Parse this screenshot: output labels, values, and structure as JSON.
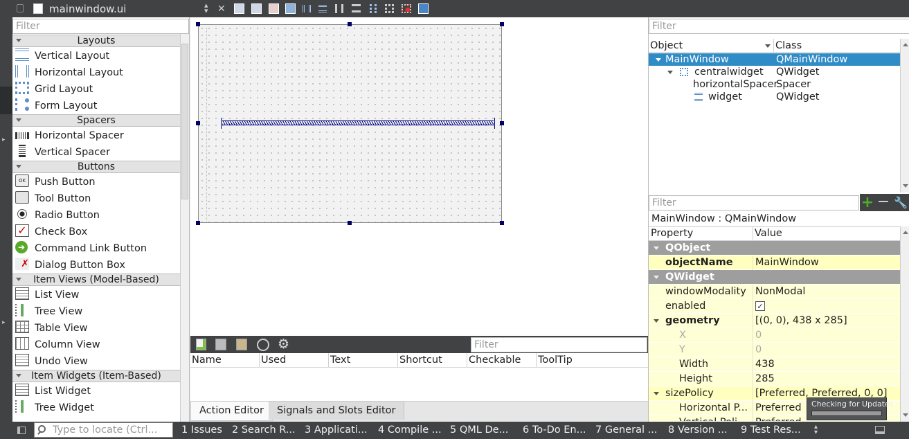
{
  "topbar": {
    "file_name": "mainwindow.ui",
    "close_symbol": "✕",
    "toolbar_icons": [
      "edit-widgets-icon",
      "edit-signals-icon",
      "edit-buddies-icon",
      "edit-tab-order-icon",
      "layout-horizontal-icon",
      "layout-vertical-icon",
      "layout-h-splitter-icon",
      "layout-v-splitter-icon",
      "layout-form-icon",
      "layout-grid-icon",
      "break-layout-icon",
      "adjust-size-icon"
    ]
  },
  "widget_box": {
    "filter_placeholder": "Filter",
    "categories": [
      {
        "label": "Layouts",
        "items": [
          {
            "label": "Vertical Layout",
            "icon": "vertical-layout-icon"
          },
          {
            "label": "Horizontal Layout",
            "icon": "horizontal-layout-icon"
          },
          {
            "label": "Grid Layout",
            "icon": "grid-layout-icon"
          },
          {
            "label": "Form Layout",
            "icon": "form-layout-icon"
          }
        ]
      },
      {
        "label": "Spacers",
        "items": [
          {
            "label": "Horizontal Spacer",
            "icon": "horizontal-spacer-icon"
          },
          {
            "label": "Vertical Spacer",
            "icon": "vertical-spacer-icon"
          }
        ]
      },
      {
        "label": "Buttons",
        "items": [
          {
            "label": "Push Button",
            "icon": "push-button-icon"
          },
          {
            "label": "Tool Button",
            "icon": "tool-button-icon"
          },
          {
            "label": "Radio Button",
            "icon": "radio-button-icon"
          },
          {
            "label": "Check Box",
            "icon": "check-box-icon"
          },
          {
            "label": "Command Link Button",
            "icon": "command-link-icon"
          },
          {
            "label": "Dialog Button Box",
            "icon": "dialog-button-box-icon"
          }
        ]
      },
      {
        "label": "Item Views (Model-Based)",
        "items": [
          {
            "label": "List View",
            "icon": "list-view-icon"
          },
          {
            "label": "Tree View",
            "icon": "tree-view-icon"
          },
          {
            "label": "Table View",
            "icon": "table-view-icon"
          },
          {
            "label": "Column View",
            "icon": "column-view-icon"
          },
          {
            "label": "Undo View",
            "icon": "undo-view-icon"
          }
        ]
      },
      {
        "label": "Item Widgets (Item-Based)",
        "items": [
          {
            "label": "List Widget",
            "icon": "list-widget-icon"
          },
          {
            "label": "Tree Widget",
            "icon": "tree-widget-icon"
          }
        ]
      }
    ]
  },
  "action_editor": {
    "filter_placeholder": "Filter",
    "columns": [
      "Name",
      "Used",
      "Text",
      "Shortcut",
      "Checkable",
      "ToolTip"
    ]
  },
  "bottom_tabs": [
    "Action Editor",
    "Signals and Slots Editor"
  ],
  "object_inspector": {
    "filter_placeholder": "Filter",
    "columns": [
      "Object",
      "Class"
    ],
    "rows": [
      {
        "object": "MainWindow",
        "class": "QMainWindow"
      },
      {
        "object": "centralwidget",
        "class": "QWidget"
      },
      {
        "object": "horizontalSpacer",
        "class": "Spacer"
      },
      {
        "object": "widget",
        "class": "QWidget"
      }
    ]
  },
  "property_editor": {
    "filter_placeholder": "Filter",
    "context": "MainWindow : QMainWindow",
    "columns": [
      "Property",
      "Value"
    ],
    "rows": [
      {
        "name": "QObject",
        "value": ""
      },
      {
        "name": "objectName",
        "value": "MainWindow"
      },
      {
        "name": "QWidget",
        "value": ""
      },
      {
        "name": "windowModality",
        "value": "NonModal"
      },
      {
        "name": "enabled",
        "value": "✓"
      },
      {
        "name": "geometry",
        "value": "[(0, 0), 438 x 285]"
      },
      {
        "name": "X",
        "value": "0"
      },
      {
        "name": "Y",
        "value": "0"
      },
      {
        "name": "Width",
        "value": "438"
      },
      {
        "name": "Height",
        "value": "285"
      },
      {
        "name": "sizePolicy",
        "value": "[Preferred, Preferred, 0, 0]"
      },
      {
        "name": "Horizontal P...",
        "value": "Preferred"
      },
      {
        "name": "Vertical Poli...",
        "value": "Preferred"
      }
    ]
  },
  "toast": {
    "text": "Checking for Updates"
  },
  "statusbar": {
    "locate_placeholder": "Type to locate (Ctrl...",
    "panes": [
      "1  Issues",
      "2  Search R...",
      "3  Applicati...",
      "4  Compile ...",
      "5  QML De...",
      "6  To-Do En...",
      "7  General ...",
      "8  Version ...",
      "9  Test Res..."
    ]
  }
}
